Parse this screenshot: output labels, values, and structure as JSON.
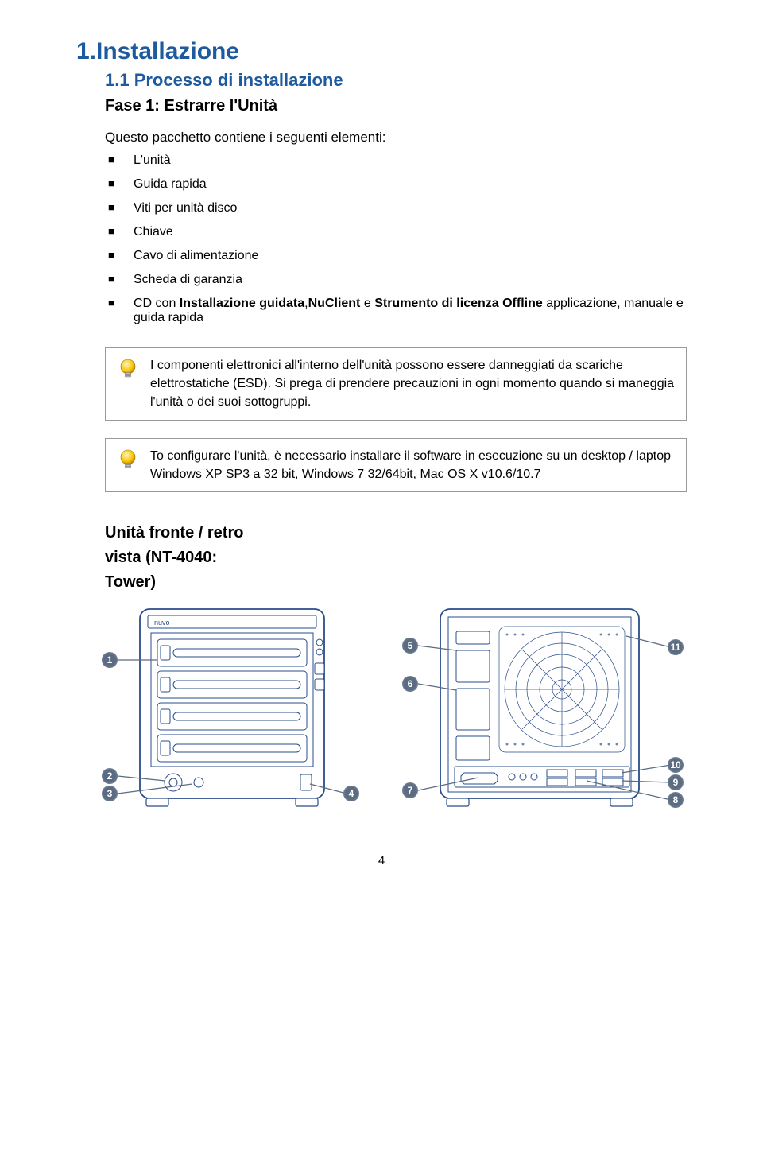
{
  "headings": {
    "h1": "1.Installazione",
    "h2": "1.1 Processo di installazione",
    "h3": "Fase 1: Estrarre l'Unità",
    "intro": "Questo pacchetto contiene i seguenti elementi:",
    "section_title_1": "Unità fronte / retro",
    "section_title_2": "vista (NT-4040:",
    "section_title_3": "Tower)"
  },
  "package_items": [
    "L'unità",
    "Guida rapida",
    "Viti per unità disco",
    "Chiave",
    "Cavo di alimentazione",
    "Scheda di garanzia"
  ],
  "cd_item": {
    "prefix": "CD con ",
    "bold1": "Installazione guidata",
    "mid1": ",",
    "bold2": "NuClient",
    "mid2": " e ",
    "bold3": "Strumento di licenza Offline",
    "suffix": " applicazione, manuale e guida rapida"
  },
  "note1": "I componenti elettronici all'interno dell'unità possono essere danneggiati da scariche elettrostatiche (ESD). Si prega di prendere precauzioni in ogni momento quando si maneggia l'unità o dei suoi sottogruppi.",
  "note2": "To configurare l'unità, è necessario installare il software in esecuzione su un desktop / laptop Windows XP SP3 a 32 bit, Windows 7 32/64bit, Mac OS X v10.6/10.7",
  "callouts_front": [
    "1",
    "2",
    "3",
    "4"
  ],
  "callouts_rear": [
    "5",
    "6",
    "7",
    "8",
    "9",
    "10",
    "11"
  ],
  "page_number": "4"
}
